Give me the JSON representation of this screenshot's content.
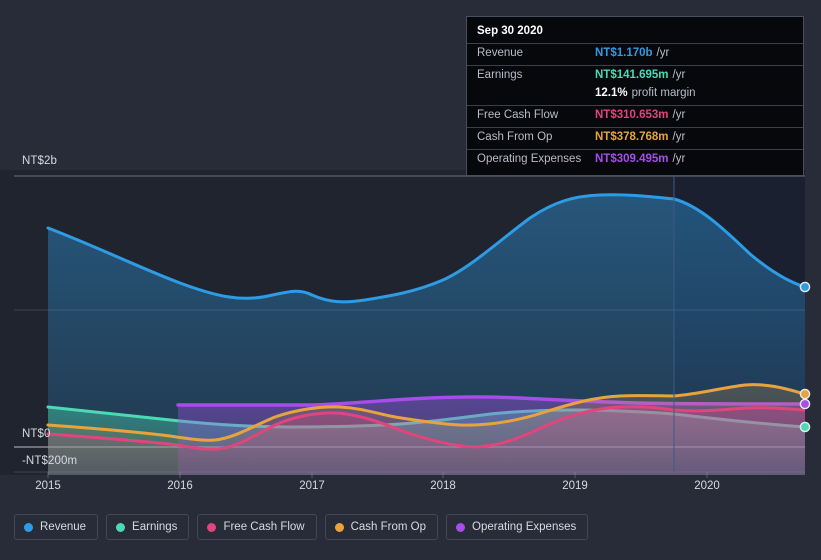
{
  "tooltip": {
    "title": "Sep 30 2020",
    "rows": [
      {
        "label": "Revenue",
        "value": "NT$1.170b",
        "suffix": "/yr",
        "color": "#2e9ce5"
      },
      {
        "label": "Earnings",
        "value": "NT$141.695m",
        "suffix": "/yr",
        "color": "#4adbb5"
      },
      {
        "label": "",
        "value": "12.1%",
        "suffix": "profit margin",
        "color": "#ffffff"
      },
      {
        "label": "Free Cash Flow",
        "value": "NT$310.653m",
        "suffix": "/yr",
        "color": "#e0457b"
      },
      {
        "label": "Cash From Op",
        "value": "NT$378.768m",
        "suffix": "/yr",
        "color": "#e8a33d"
      },
      {
        "label": "Operating Expenses",
        "value": "NT$309.495m",
        "suffix": "/yr",
        "color": "#a64ee8"
      }
    ]
  },
  "legend": {
    "items": [
      {
        "label": "Revenue",
        "color": "#2e9ce5"
      },
      {
        "label": "Earnings",
        "color": "#4adbb5"
      },
      {
        "label": "Free Cash Flow",
        "color": "#e0457b"
      },
      {
        "label": "Cash From Op",
        "color": "#e8a33d"
      },
      {
        "label": "Operating Expenses",
        "color": "#a64ee8"
      }
    ]
  },
  "axes": {
    "y_labels": [
      "NT$2b",
      "NT$0",
      "-NT$200m"
    ],
    "x_labels": [
      "2015",
      "2016",
      "2017",
      "2018",
      "2019",
      "2020"
    ]
  },
  "chart_data": {
    "type": "area",
    "title": "",
    "xlabel": "",
    "ylabel": "",
    "currency": "NTD",
    "ylim": [
      -200,
      2000
    ],
    "y_ticks": [
      {
        "label": "NT$2b",
        "value": 2000
      },
      {
        "label": "NT$0",
        "value": 0
      },
      {
        "label": "-NT$200m",
        "value": -200
      }
    ],
    "grid": true,
    "legend_position": "bottom",
    "forecast_divider_x": "2019-09",
    "x": [
      "2015-01",
      "2015-06",
      "2016-01",
      "2016-06",
      "2017-01",
      "2017-06",
      "2018-01",
      "2018-06",
      "2019-01",
      "2019-06",
      "2020-01",
      "2020-09"
    ],
    "x_tick_labels": [
      "2015",
      "2016",
      "2017",
      "2018",
      "2019",
      "2020"
    ],
    "series": [
      {
        "name": "Revenue",
        "color": "#2e9ce5",
        "units": "NT$m",
        "values": [
          1610,
          1430,
          1200,
          1115,
          1180,
          1135,
          1160,
          1350,
          1640,
          1665,
          1480,
          1170
        ]
      },
      {
        "name": "Earnings",
        "color": "#4adbb5",
        "units": "NT$m",
        "values": [
          295,
          250,
          205,
          185,
          175,
          175,
          175,
          185,
          210,
          205,
          185,
          142
        ]
      },
      {
        "name": "Free Cash Flow",
        "color": "#e0457b",
        "units": "NT$m",
        "values": [
          100,
          85,
          60,
          -15,
          120,
          120,
          95,
          0,
          120,
          180,
          170,
          311
        ]
      },
      {
        "name": "Cash From Op",
        "color": "#e8a33d",
        "units": "NT$m",
        "values": [
          175,
          165,
          150,
          50,
          230,
          180,
          130,
          115,
          230,
          265,
          330,
          379
        ]
      },
      {
        "name": "Operating Expenses",
        "color": "#a64ee8",
        "units": "NT$m",
        "values": [
          null,
          null,
          300,
          300,
          300,
          315,
          330,
          340,
          330,
          320,
          310,
          309
        ]
      }
    ]
  }
}
